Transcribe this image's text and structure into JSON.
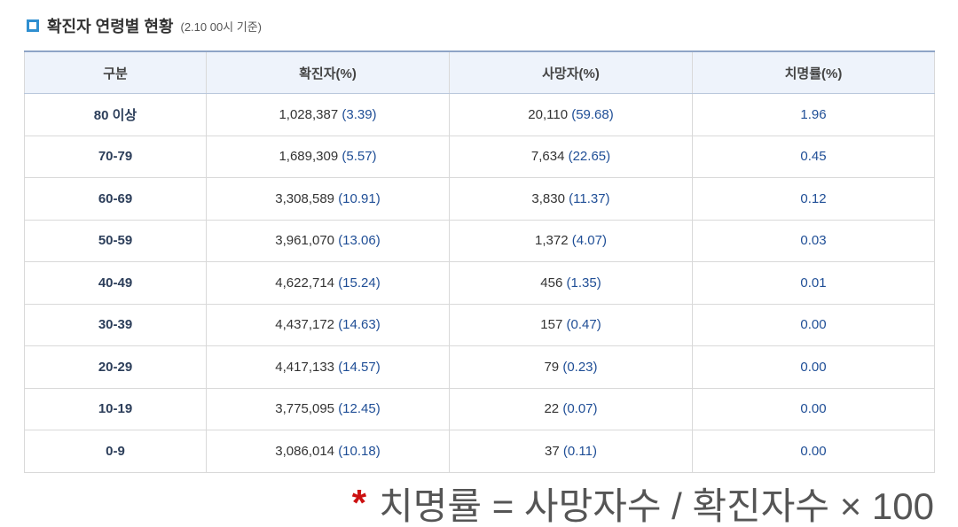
{
  "header": {
    "title": "확진자 연령별 현황",
    "date_note": "(2.10 00시 기준)"
  },
  "table": {
    "columns": [
      "구분",
      "확진자(%)",
      "사망자(%)",
      "치명률(%)"
    ],
    "rows": [
      {
        "age": "80 이상",
        "cases": "1,028,387",
        "cases_pct": "(3.39)",
        "deaths": "20,110",
        "deaths_pct": "(59.68)",
        "fatality": "1.96"
      },
      {
        "age": "70-79",
        "cases": "1,689,309",
        "cases_pct": "(5.57)",
        "deaths": "7,634",
        "deaths_pct": "(22.65)",
        "fatality": "0.45"
      },
      {
        "age": "60-69",
        "cases": "3,308,589",
        "cases_pct": "(10.91)",
        "deaths": "3,830",
        "deaths_pct": "(11.37)",
        "fatality": "0.12"
      },
      {
        "age": "50-59",
        "cases": "3,961,070",
        "cases_pct": "(13.06)",
        "deaths": "1,372",
        "deaths_pct": "(4.07)",
        "fatality": "0.03"
      },
      {
        "age": "40-49",
        "cases": "4,622,714",
        "cases_pct": "(15.24)",
        "deaths": "456",
        "deaths_pct": "(1.35)",
        "fatality": "0.01"
      },
      {
        "age": "30-39",
        "cases": "4,437,172",
        "cases_pct": "(14.63)",
        "deaths": "157",
        "deaths_pct": "(0.47)",
        "fatality": "0.00"
      },
      {
        "age": "20-29",
        "cases": "4,417,133",
        "cases_pct": "(14.57)",
        "deaths": "79",
        "deaths_pct": "(0.23)",
        "fatality": "0.00"
      },
      {
        "age": "10-19",
        "cases": "3,775,095",
        "cases_pct": "(12.45)",
        "deaths": "22",
        "deaths_pct": "(0.07)",
        "fatality": "0.00"
      },
      {
        "age": "0-9",
        "cases": "3,086,014",
        "cases_pct": "(10.18)",
        "deaths": "37",
        "deaths_pct": "(0.11)",
        "fatality": "0.00"
      }
    ]
  },
  "footnote": {
    "marker": "*",
    "text": "치명률 = 사망자수 / 확진자수 × 100"
  },
  "colors": {
    "accent_blue": "#1f4e96",
    "bullet_blue": "#2f8fd0",
    "header_bg": "#eef3fb",
    "footnote_star": "#cc1111"
  }
}
